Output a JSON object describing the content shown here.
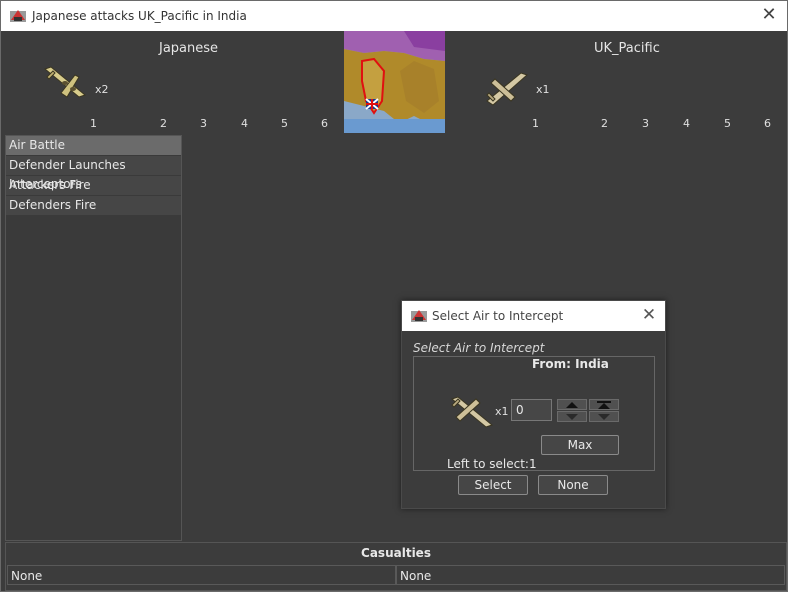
{
  "window": {
    "title": "Japanese attacks UK_Pacific in India",
    "close": "✕"
  },
  "attacker": {
    "name": "Japanese",
    "units": [
      {
        "icon": "bomber-plane-icon",
        "multiplier": "x2"
      }
    ],
    "dice": [
      "1",
      "2",
      "3",
      "4",
      "5",
      "6"
    ]
  },
  "defender": {
    "name": "UK_Pacific",
    "units": [
      {
        "icon": "fighter-plane-icon",
        "multiplier": "x1"
      }
    ],
    "dice": [
      "1",
      "2",
      "3",
      "4",
      "5",
      "6"
    ]
  },
  "steps": [
    {
      "label": "Air Battle",
      "selected": true
    },
    {
      "label": "Defender Launches Interceptors",
      "selected": false
    },
    {
      "label": "Attackers Fire",
      "selected": false
    },
    {
      "label": "Defenders Fire",
      "selected": false
    }
  ],
  "casualties": {
    "title": "Casualties",
    "attacker_value": "None",
    "defender_value": "None"
  },
  "dialog": {
    "title": "Select Air to Intercept",
    "close": "✕",
    "heading": "Select Air to Intercept",
    "from_label": "From: India",
    "unit_icon": "fighter-plane-icon",
    "unit_multiplier": "x1",
    "quantity": "0",
    "max_label": "Max",
    "left_to_select": "Left to select:1",
    "select_label": "Select",
    "none_label": "None"
  },
  "colors": {
    "background": "#3c3c3c",
    "selected_step": "#6b6b6b",
    "titlebar": "#ffffff"
  }
}
